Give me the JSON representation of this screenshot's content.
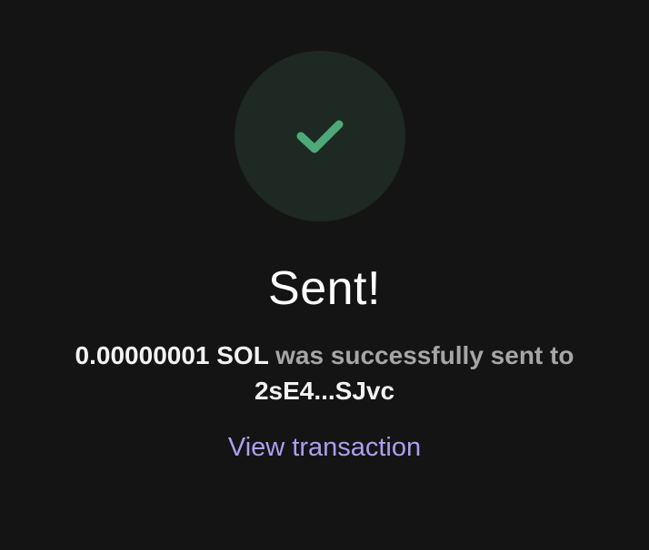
{
  "status": {
    "icon": "checkmark-icon",
    "icon_color": "#4fa877",
    "circle_color": "#1d2922",
    "title": "Sent!"
  },
  "message": {
    "amount": "0.00000001 SOL",
    "connector": "was successfully sent to",
    "recipient": "2sE4...SJvc"
  },
  "actions": {
    "view_transaction_label": "View transaction",
    "link_color": "#ab9ff2"
  },
  "theme": {
    "background": "#141414"
  }
}
